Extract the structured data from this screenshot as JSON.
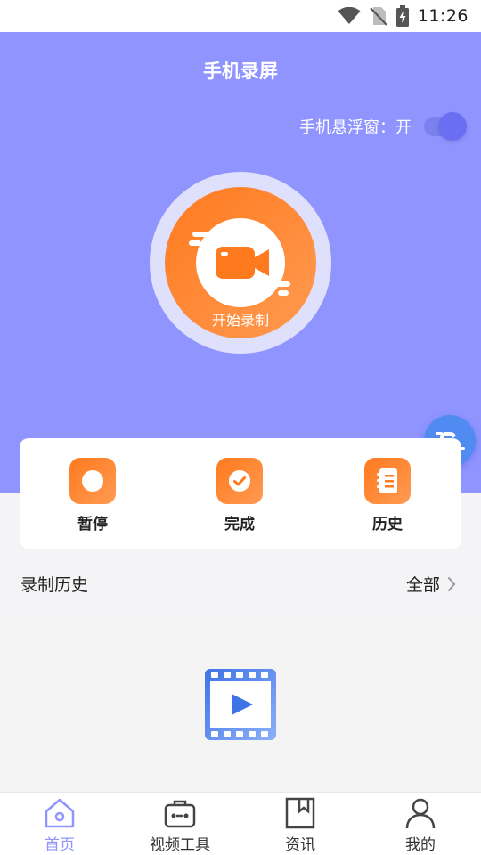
{
  "status_bar": {
    "time": "11:26",
    "icons": [
      "wifi-icon",
      "no-sim-icon",
      "battery-charging-icon"
    ]
  },
  "header": {
    "title": "手机录屏"
  },
  "floating_window": {
    "label": "手机悬浮窗：开",
    "enabled": true
  },
  "record": {
    "label": "开始录制",
    "icon": "video-camera-icon"
  },
  "actions": [
    {
      "label": "暂停",
      "icon": "pause-icon"
    },
    {
      "label": "完成",
      "icon": "check-icon"
    },
    {
      "label": "历史",
      "icon": "notebook-icon"
    }
  ],
  "history": {
    "title": "录制历史",
    "all_label": "全部",
    "empty_icon": "video-play-icon"
  },
  "bottom_nav": {
    "items": [
      {
        "label": "首页",
        "icon": "home-icon",
        "active": true
      },
      {
        "label": "视频工具",
        "icon": "toolbox-icon",
        "active": false
      },
      {
        "label": "资讯",
        "icon": "bookmark-icon",
        "active": false
      },
      {
        "label": "我的",
        "icon": "user-icon",
        "active": false
      }
    ]
  },
  "colors": {
    "brand_purple": "#8f94ff",
    "accent_orange": "#ff7a1e",
    "bubble_blue": "#4f8bf0"
  }
}
